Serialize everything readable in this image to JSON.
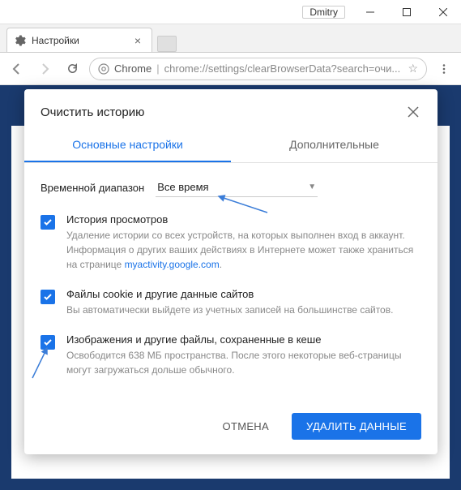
{
  "window": {
    "user": "Dmitry"
  },
  "browser_tab": {
    "title": "Настройки"
  },
  "omnibox": {
    "secure_label": "Chrome",
    "url": "chrome://settings/clearBrowserData?search=очи..."
  },
  "dialog": {
    "title": "Очистить историю",
    "tabs": {
      "basic": "Основные настройки",
      "advanced": "Дополнительные"
    },
    "timerange": {
      "label": "Временной диапазон",
      "value": "Все время"
    },
    "options": [
      {
        "title": "История просмотров",
        "desc_before": "Удаление истории со всех устройств, на которых выполнен вход в аккаунт. Информация о других ваших действиях в Интернете может также храниться на странице ",
        "link": "myactivity.google.com",
        "desc_after": "."
      },
      {
        "title": "Файлы cookie и другие данные сайтов",
        "desc_before": "Вы автоматически выйдете из учетных записей на большинстве сайтов.",
        "link": "",
        "desc_after": ""
      },
      {
        "title": "Изображения и другие файлы, сохраненные в кеше",
        "desc_before": "Освободится 638 МБ пространства. После этого некоторые веб-страницы могут загружаться дольше обычного.",
        "link": "",
        "desc_after": ""
      }
    ],
    "buttons": {
      "cancel": "ОТМЕНА",
      "confirm": "УДАЛИТЬ ДАННЫЕ"
    }
  }
}
